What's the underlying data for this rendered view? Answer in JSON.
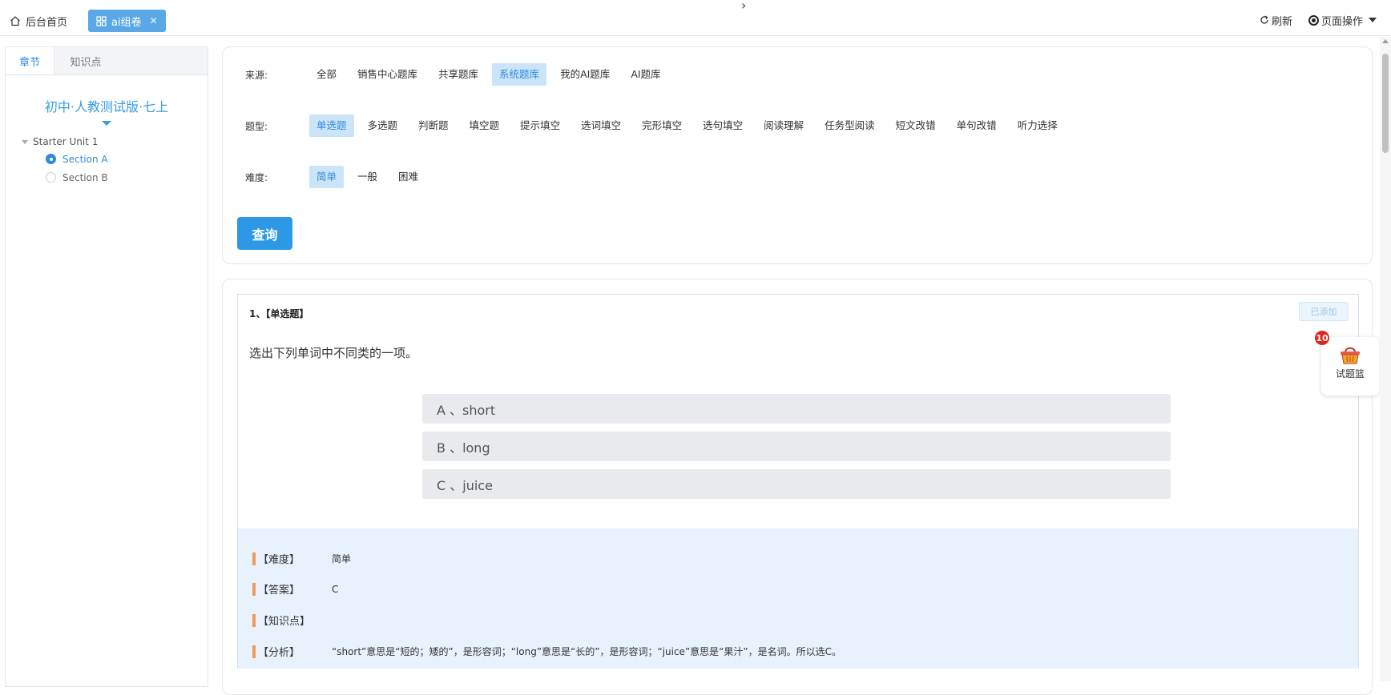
{
  "topbar": {
    "home_label": "后台首页",
    "active_tab_label": "ai组卷",
    "refresh_label": "刷新",
    "page_ops_label": "页面操作"
  },
  "left": {
    "tabs": [
      {
        "label": "章节",
        "active": true
      },
      {
        "label": "知识点",
        "active": false
      }
    ],
    "book_title": "初中·人教测试版·七上",
    "unit": "Starter Unit 1",
    "sections": [
      {
        "label": "Section A",
        "selected": true
      },
      {
        "label": "Section B",
        "selected": false
      }
    ]
  },
  "filters": {
    "source_label": "来源:",
    "sources": [
      "全部",
      "销售中心题库",
      "共享题库",
      "系统题库",
      "我的AI题库",
      "AI题库"
    ],
    "source_selected": "系统题库",
    "type_label": "题型:",
    "types": [
      "单选题",
      "多选题",
      "判断题",
      "填空题",
      "提示填空",
      "选词填空",
      "完形填空",
      "选句填空",
      "阅读理解",
      "任务型阅读",
      "短文改错",
      "单句改错",
      "听力选择"
    ],
    "type_selected": "单选题",
    "difficulty_label": "难度:",
    "difficulties": [
      "简单",
      "一般",
      "困难"
    ],
    "difficulty_selected": "简单",
    "query_label": "查询"
  },
  "question": {
    "header": "1、【单选题】",
    "added_label": "已添加",
    "stem": "选出下列单词中不同类的一项。",
    "options": [
      "A 、short",
      "B 、long",
      "C 、juice"
    ],
    "analysis": {
      "difficulty_label": "【难度】",
      "difficulty_value": "简单",
      "answer_label": "【答案】",
      "answer_value": "C",
      "knowledge_label": "【知识点】",
      "knowledge_value": "",
      "analysis_label": "【分析】",
      "analysis_value": "“short”意思是“短的；矮的”，是形容词；“long”意思是“长的”，是形容词；“juice”意思是“果汁”，是名词。所以选C。"
    }
  },
  "basket": {
    "count": "10",
    "label": "试题篮"
  },
  "colors": {
    "accent": "#2f8be0",
    "selected_bg": "#cce4f7",
    "query_button": "#2d98e6",
    "badge": "#e0241b",
    "analysis_bg": "#e8f2fc",
    "analysis_bar": "#ee9a5a"
  }
}
